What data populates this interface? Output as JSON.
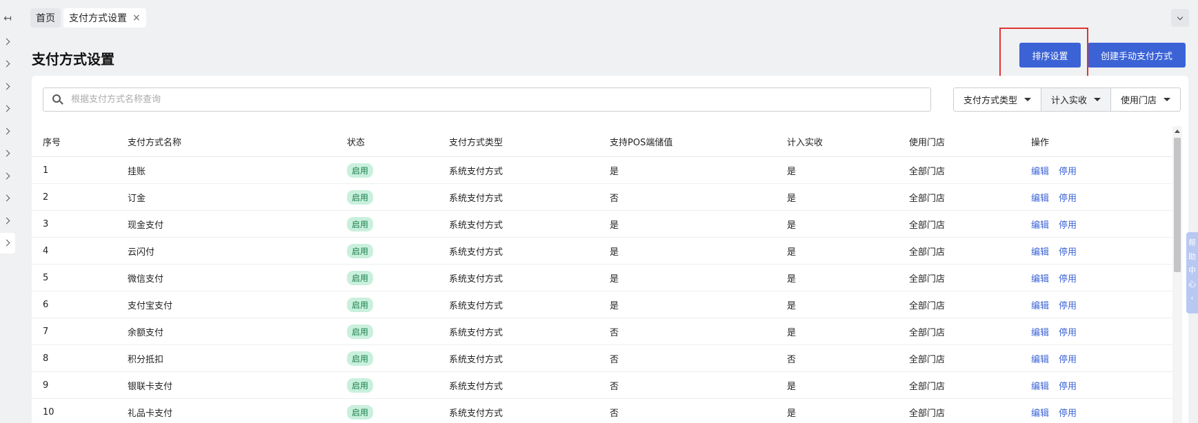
{
  "rail": {
    "collapse_glyph": "↤",
    "chevron_count": 10
  },
  "tabs": [
    {
      "label": "首页"
    },
    {
      "label": "支付方式设置",
      "close": "×"
    }
  ],
  "page": {
    "title": "支付方式设置",
    "sort_button": "排序设置",
    "create_button": "创建手动支付方式"
  },
  "search": {
    "placeholder": "根据支付方式名称查询",
    "value": ""
  },
  "filters": [
    {
      "label": "支付方式类型"
    },
    {
      "label": "计入实收"
    },
    {
      "label": "使用门店"
    }
  ],
  "table": {
    "headers": [
      "序号",
      "支付方式名称",
      "状态",
      "支付方式类型",
      "支持POS端储值",
      "计入实收",
      "使用门店",
      "操作"
    ],
    "rows": [
      {
        "no": "1",
        "name": "挂账",
        "status": "启用",
        "type": "系统支付方式",
        "pos": "是",
        "income": "是",
        "store": "全部门店"
      },
      {
        "no": "2",
        "name": "订金",
        "status": "启用",
        "type": "系统支付方式",
        "pos": "否",
        "income": "是",
        "store": "全部门店"
      },
      {
        "no": "3",
        "name": "现金支付",
        "status": "启用",
        "type": "系统支付方式",
        "pos": "是",
        "income": "是",
        "store": "全部门店"
      },
      {
        "no": "4",
        "name": "云闪付",
        "status": "启用",
        "type": "系统支付方式",
        "pos": "是",
        "income": "是",
        "store": "全部门店"
      },
      {
        "no": "5",
        "name": "微信支付",
        "status": "启用",
        "type": "系统支付方式",
        "pos": "是",
        "income": "是",
        "store": "全部门店"
      },
      {
        "no": "6",
        "name": "支付宝支付",
        "status": "启用",
        "type": "系统支付方式",
        "pos": "是",
        "income": "是",
        "store": "全部门店"
      },
      {
        "no": "7",
        "name": "余额支付",
        "status": "启用",
        "type": "系统支付方式",
        "pos": "否",
        "income": "是",
        "store": "全部门店"
      },
      {
        "no": "8",
        "name": "积分抵扣",
        "status": "启用",
        "type": "系统支付方式",
        "pos": "否",
        "income": "否",
        "store": "全部门店"
      },
      {
        "no": "9",
        "name": "银联卡支付",
        "status": "启用",
        "type": "系统支付方式",
        "pos": "否",
        "income": "是",
        "store": "全部门店"
      },
      {
        "no": "10",
        "name": "礼品卡支付",
        "status": "启用",
        "type": "系统支付方式",
        "pos": "否",
        "income": "是",
        "store": "全部门店"
      }
    ],
    "actions": {
      "edit": "编辑",
      "disable": "停用"
    }
  },
  "help": {
    "chars": [
      "帮",
      "助",
      "中",
      "心",
      "‹"
    ]
  },
  "colors": {
    "primary": "#3b63d6",
    "highlight": "#e03131",
    "badge_bg": "#c9f0dd",
    "badge_text": "#1a7f4b"
  }
}
